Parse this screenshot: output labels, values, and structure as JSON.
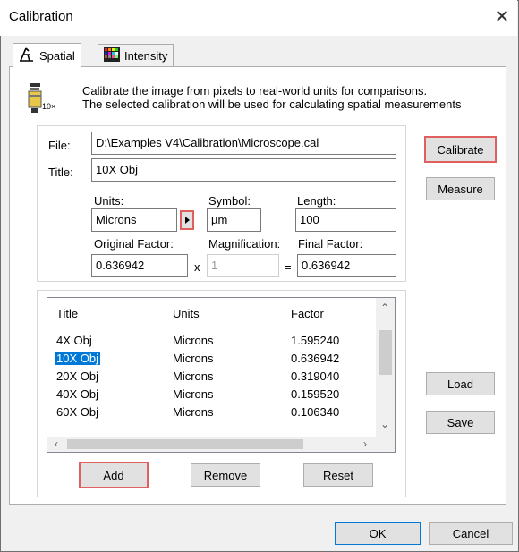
{
  "window": {
    "title": "Calibration"
  },
  "tabs": [
    {
      "label": "Spatial",
      "icon": "caliper-icon",
      "active": true
    },
    {
      "label": "Intensity",
      "icon": "color-grid-icon",
      "active": false
    }
  ],
  "info": {
    "icon": "microscope-objective-icon",
    "icon_caption": "10×",
    "line1": "Calibrate the image from pixels to real-world units for comparisons.",
    "line2": "The selected calibration will be used for calculating spatial measurements"
  },
  "form": {
    "file_label": "File:",
    "file_value": "D:\\Examples V4\\Calibration\\Microscope.cal",
    "title_label": "Title:",
    "title_value": "10X Obj",
    "units_label": "Units:",
    "units_value": "Microns",
    "symbol_label": "Symbol:",
    "symbol_value": "µm",
    "length_label": "Length:",
    "length_value": "100",
    "orig_factor_label": "Original Factor:",
    "orig_factor_value": "0.636942",
    "times_sign": "x",
    "magnification_label": "Magnification:",
    "magnification_value": "1",
    "equals_sign": "=",
    "final_factor_label": "Final Factor:",
    "final_factor_value": "0.636942"
  },
  "side_buttons": {
    "calibrate": "Calibrate",
    "measure": "Measure",
    "load": "Load",
    "save": "Save"
  },
  "table": {
    "columns": [
      "Title",
      "Units",
      "Factor"
    ],
    "rows": [
      [
        "4X Obj",
        "Microns",
        "1.595240"
      ],
      [
        "10X Obj",
        "Microns",
        "0.636942"
      ],
      [
        "20X Obj",
        "Microns",
        "0.319040"
      ],
      [
        "40X Obj",
        "Microns",
        "0.159520"
      ],
      [
        "60X Obj",
        "Microns",
        "0.106340"
      ]
    ],
    "selected_row": 1
  },
  "list_buttons": {
    "add": "Add",
    "remove": "Remove",
    "reset": "Reset"
  },
  "footer": {
    "ok": "OK",
    "cancel": "Cancel"
  },
  "colors": {
    "highlight": "#e06060",
    "selection": "#0078d7"
  }
}
